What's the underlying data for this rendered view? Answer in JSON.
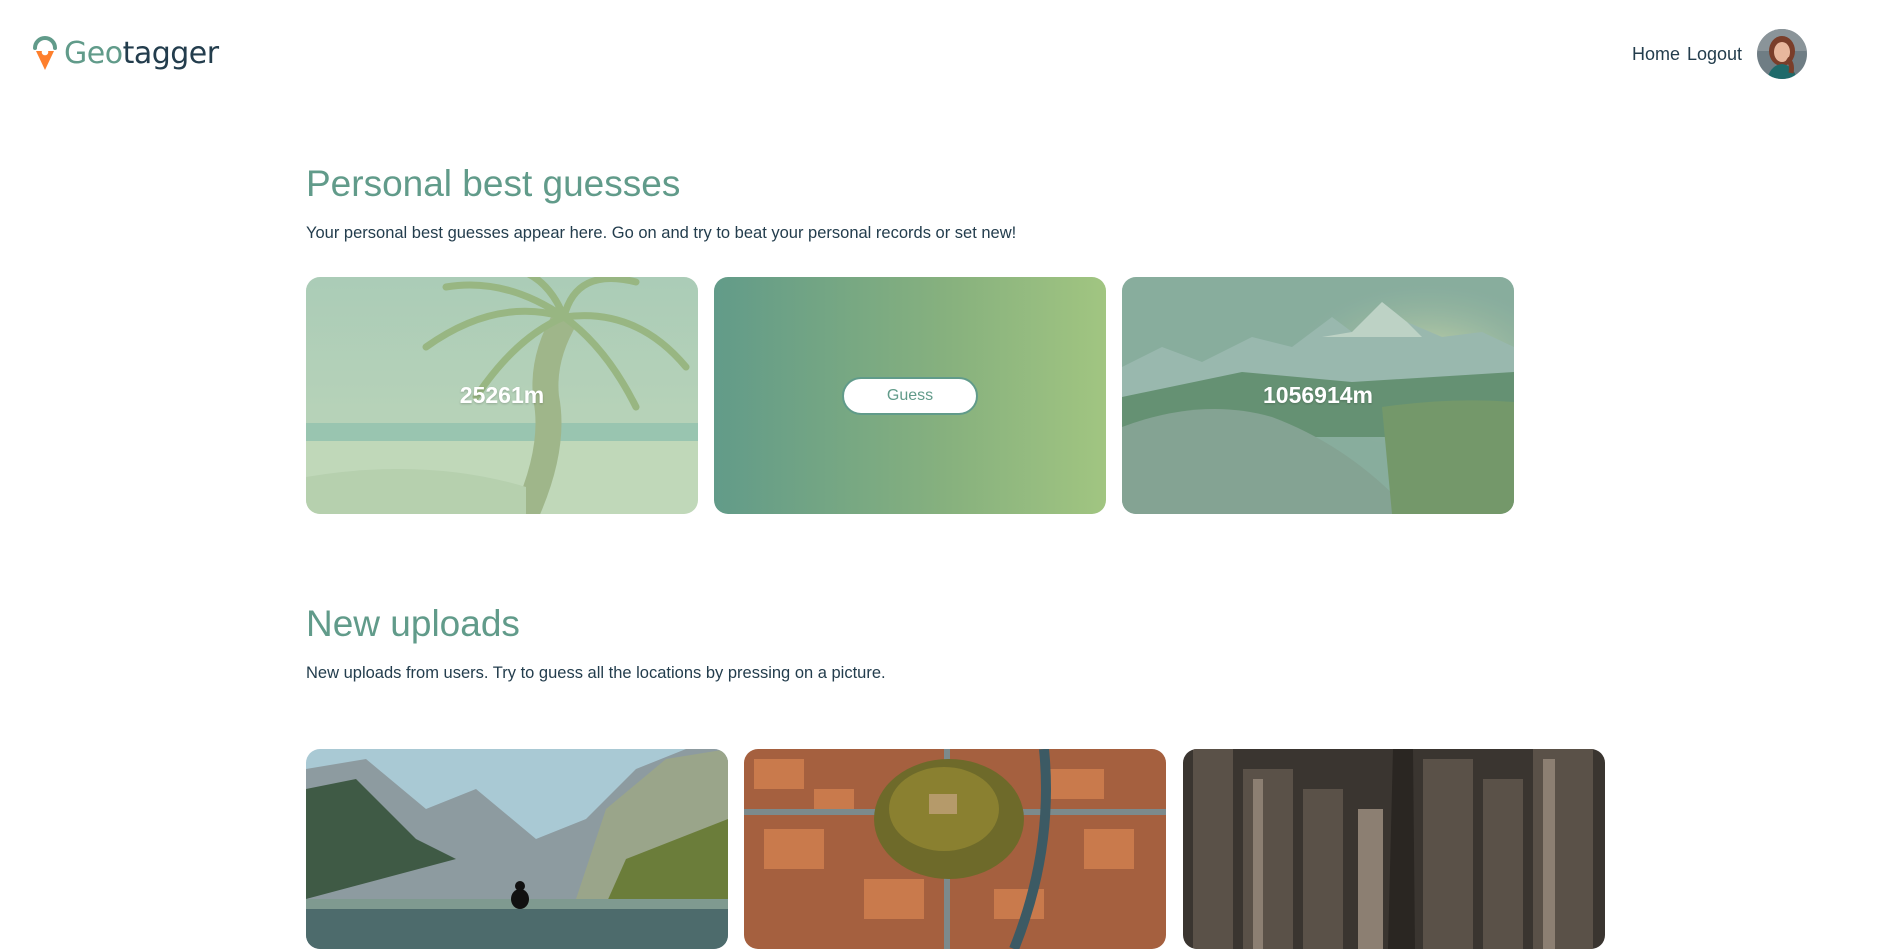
{
  "header": {
    "logo": {
      "part1": "Geo",
      "part2": "tagger"
    },
    "nav": {
      "home": "Home",
      "logout": "Logout"
    },
    "avatar_icon": "user-avatar"
  },
  "colors": {
    "brand_green": "#619b8a",
    "brand_orange": "#fe7f2d",
    "brand_dark": "#233d4d",
    "gradient_start": "#629b89",
    "gradient_end": "#a1c581"
  },
  "personal_best": {
    "title": "Personal best guesses",
    "description": "Your personal best guesses appear here. Go on and try to beat your personal records or set new!",
    "cards": [
      {
        "value": "25261m",
        "scene": "tropical beach with palm tree"
      },
      {
        "button": "Guess"
      },
      {
        "value": "1056914m",
        "scene": "mountain sunrise"
      }
    ]
  },
  "new_uploads": {
    "title": "New uploads",
    "description": "New uploads from users. Try to guess all the locations by pressing on a picture.",
    "cards": [
      {
        "scene": "alpine lake with person"
      },
      {
        "scene": "aerial city with castle hill"
      },
      {
        "scene": "aerial skyscrapers"
      }
    ]
  }
}
